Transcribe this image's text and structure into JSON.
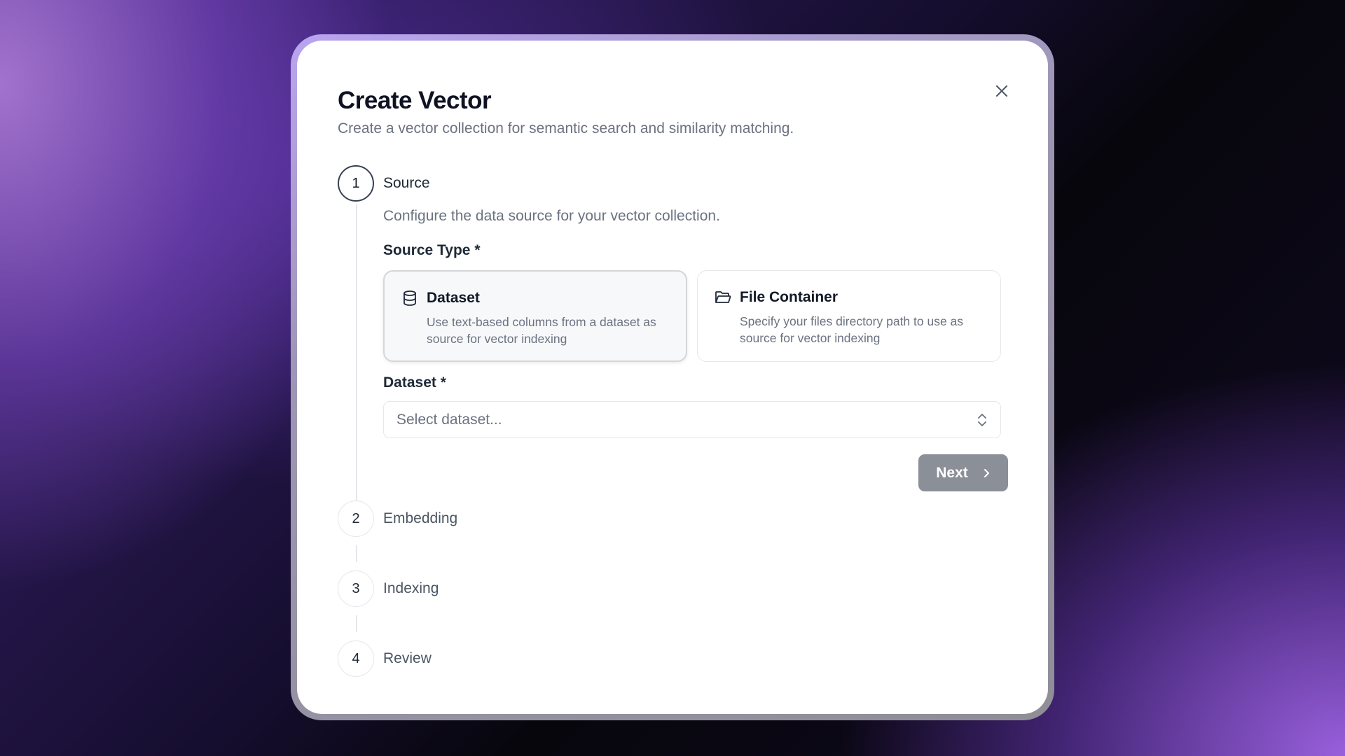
{
  "dialog": {
    "title": "Create Vector",
    "subtitle": "Create a vector collection for semantic search and similarity matching.",
    "close_icon": "close-icon"
  },
  "steps": [
    {
      "number": "1",
      "label": "Source",
      "active": true
    },
    {
      "number": "2",
      "label": "Embedding",
      "active": false
    },
    {
      "number": "3",
      "label": "Indexing",
      "active": false
    },
    {
      "number": "4",
      "label": "Review",
      "active": false
    }
  ],
  "source_step": {
    "description": "Configure the data source for your vector collection.",
    "source_type_label": "Source Type *",
    "options": [
      {
        "title": "Dataset",
        "description": "Use text-based columns from a dataset as source for vector indexing",
        "icon": "database-icon",
        "selected": true
      },
      {
        "title": "File Container",
        "description": "Specify your files directory path to use as source for vector indexing",
        "icon": "folder-open-icon",
        "selected": false
      }
    ],
    "dataset_label": "Dataset *",
    "dataset_select": {
      "placeholder": "Select dataset...",
      "icon": "chevron-up-down-icon"
    },
    "next_button": {
      "label": "Next",
      "icon": "chevron-right-icon"
    }
  },
  "colors": {
    "primary_text": "#111827",
    "muted_text": "#6b7280",
    "border": "#e5e7eb",
    "button_disabled": "#8b8f98"
  }
}
